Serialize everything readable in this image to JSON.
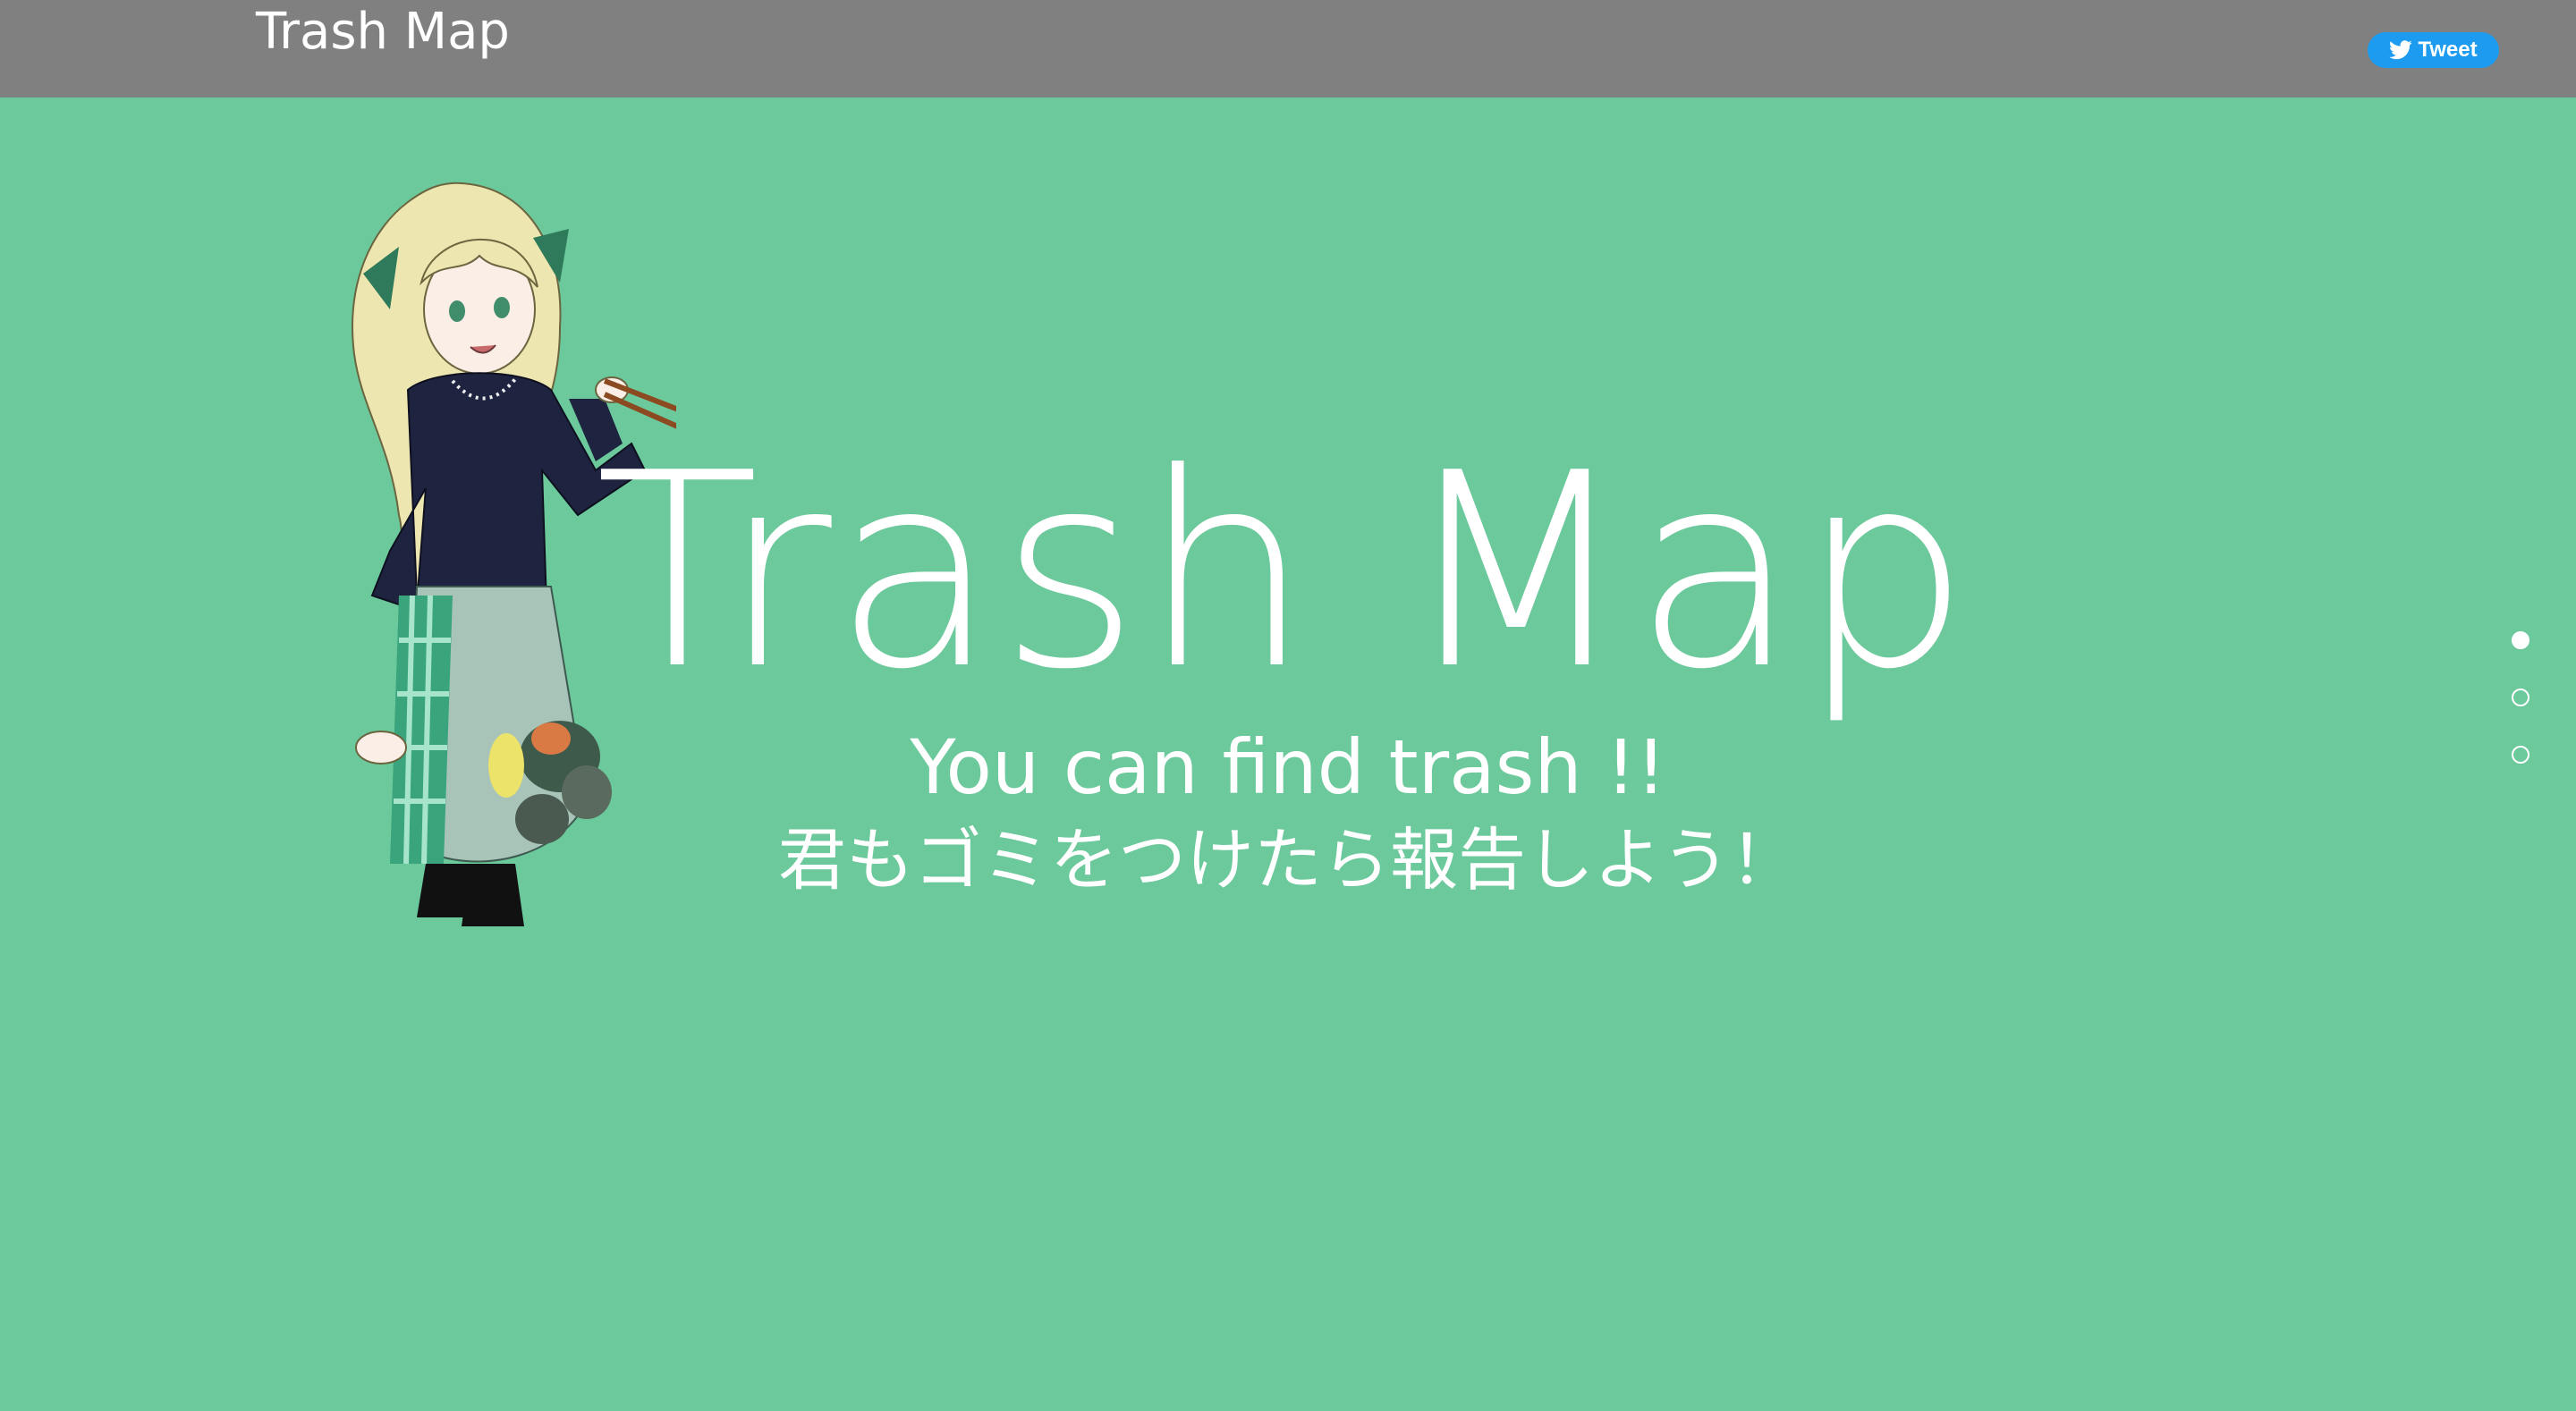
{
  "navbar": {
    "brand": "Trash Map",
    "tweet_label": "Tweet"
  },
  "hero": {
    "title": "Trash Map",
    "subtitle_en": "You can find trash !!",
    "subtitle_ja": "君もゴミをつけたら報告しよう！"
  },
  "pagination": {
    "count": 3,
    "active_index": 0
  },
  "colors": {
    "background": "#6cc99c",
    "navbar": "#808080",
    "tweet_button": "#1d9bf0",
    "text": "#ffffff"
  },
  "icons": {
    "tweet": "twitter-bird-icon",
    "character": "girl-with-trash-tongs-illustration"
  }
}
